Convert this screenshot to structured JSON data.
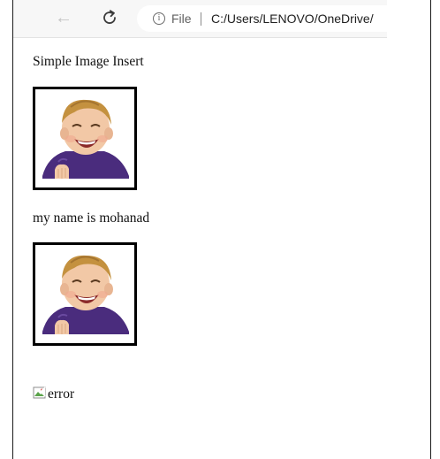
{
  "browser": {
    "scheme_label": "File",
    "url": "C:/Users/LENOVO/OneDrive/"
  },
  "page": {
    "heading": "Simple Image Insert",
    "name_line": "my name is mohanad",
    "broken_image_alt": "error"
  },
  "icons": {
    "back": "back-arrow-icon",
    "reload": "reload-icon",
    "info": "info-icon",
    "broken_image": "broken-image-icon"
  }
}
